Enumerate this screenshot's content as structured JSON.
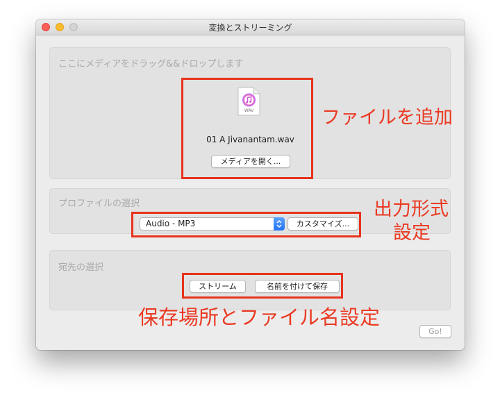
{
  "window": {
    "title": "変換とストリーミング"
  },
  "drop_panel": {
    "label": "ここにメディアをドラッグ&&ドロップします",
    "file_type": "WAV",
    "file_name": "01 A Jivanantam.wav",
    "open_button": "メディアを開く..."
  },
  "profile_panel": {
    "label": "プロファイルの選択",
    "selected_profile": "Audio - MP3",
    "customize_button": "カスタマイズ..."
  },
  "destination_panel": {
    "label": "宛先の選択",
    "stream_button": "ストリーム",
    "save_as_button": "名前を付けて保存"
  },
  "go_button": "Go!",
  "annotations": {
    "add_file": "ファイルを追加",
    "output_format_line1": "出力形式",
    "output_format_line2": "設定",
    "save_location": "保存場所とファイル名設定"
  },
  "colors": {
    "annotation": "#e8321c",
    "window_bg": "#ececec",
    "panel_bg": "#e2e2e2",
    "select_arrow": "#2f7df6"
  }
}
